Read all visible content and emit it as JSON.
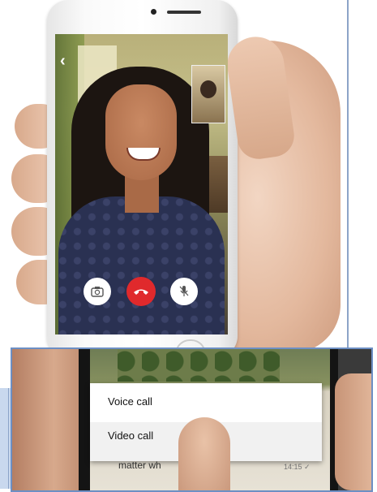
{
  "call_screen": {
    "back_glyph": "‹",
    "controls": {
      "camera_icon": "camera-switch-icon",
      "end_icon": "end-call-icon",
      "mute_icon": "microphone-mute-icon",
      "end_color": "#e0292c"
    }
  },
  "call_menu": {
    "items": [
      {
        "label": "Voice call"
      },
      {
        "label": "Video call"
      }
    ]
  },
  "chat": {
    "message_fragment": "matter wh",
    "time_fragment": "14:15 ✓"
  },
  "colors": {
    "frame_accent": "#6d8fc4",
    "end_call_red": "#e0292c"
  }
}
